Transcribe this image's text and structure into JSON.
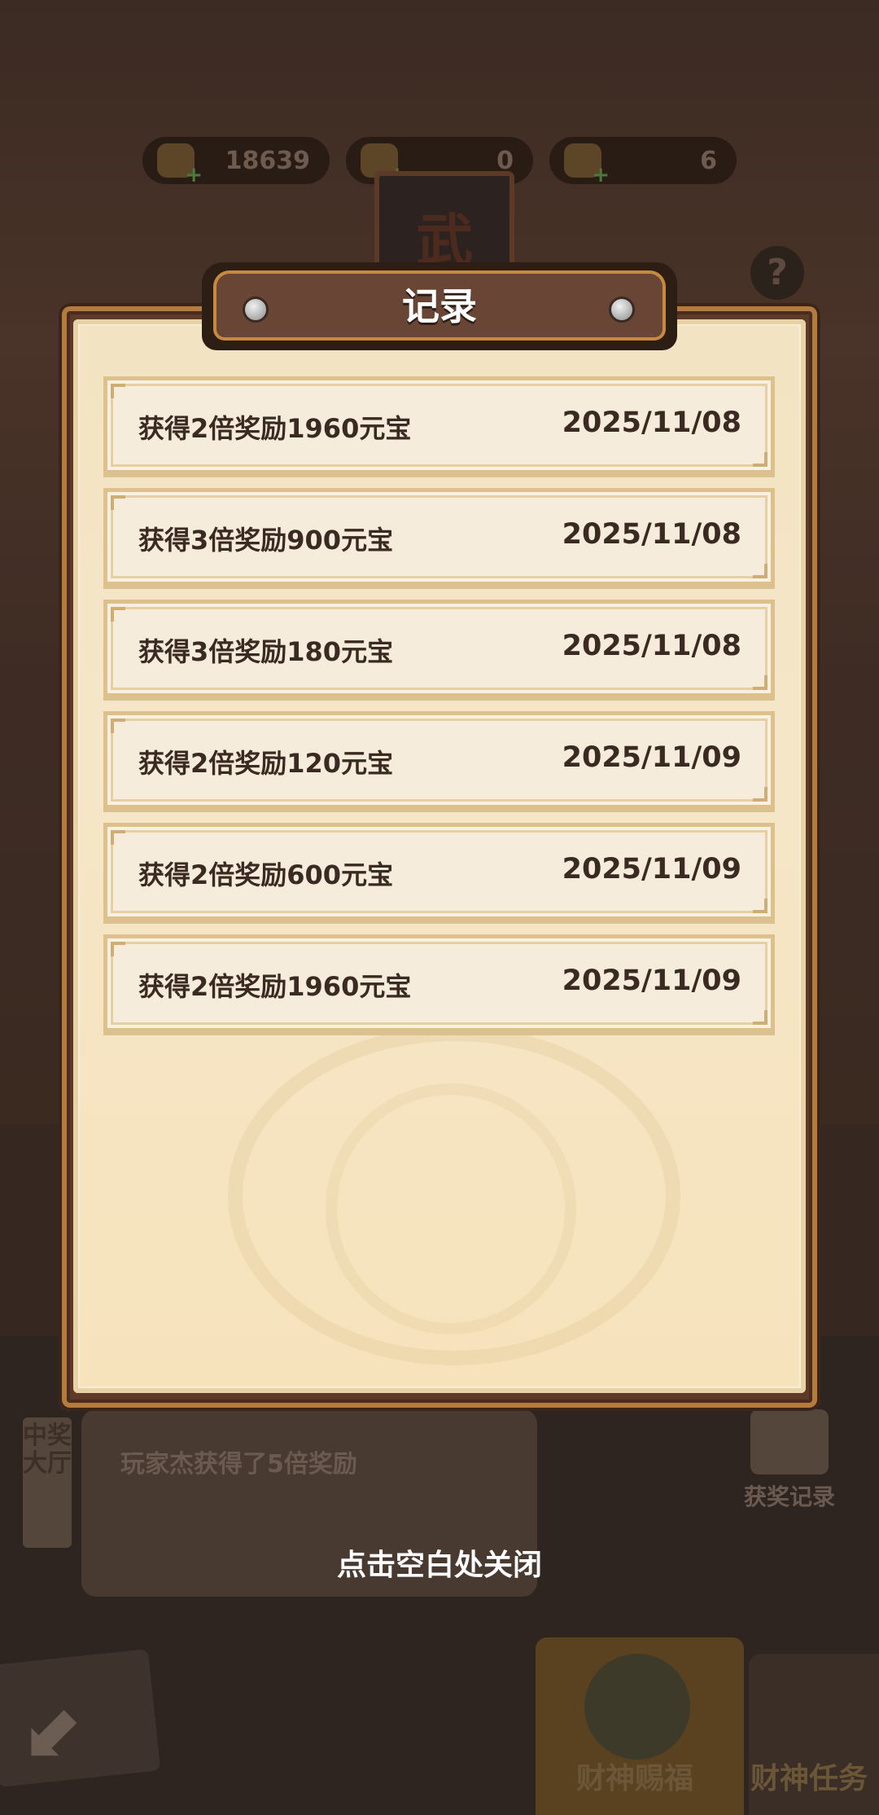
{
  "currencies": [
    {
      "icon": "gold-ingot-icon",
      "value": "18639"
    },
    {
      "icon": "leaf-token-icon",
      "value": "0"
    },
    {
      "icon": "treasure-icon",
      "value": "6"
    }
  ],
  "shrine": {
    "character": "武"
  },
  "help": {
    "label": "?"
  },
  "modal": {
    "title": "记录",
    "records": [
      {
        "desc": "获得2倍奖励1960元宝",
        "date": "2025/11/08"
      },
      {
        "desc": "获得3倍奖励900元宝",
        "date": "2025/11/08"
      },
      {
        "desc": "获得3倍奖励180元宝",
        "date": "2025/11/08"
      },
      {
        "desc": "获得2倍奖励120元宝",
        "date": "2025/11/09"
      },
      {
        "desc": "获得2倍奖励600元宝",
        "date": "2025/11/09"
      },
      {
        "desc": "获得2倍奖励1960元宝",
        "date": "2025/11/09"
      }
    ]
  },
  "ticker": {
    "side_label": "中奖大厅",
    "text": "玩家杰获得了5倍奖励"
  },
  "win_record": {
    "label": "获奖记录"
  },
  "close_hint": "点击空白处关闭",
  "bottom_tabs": [
    {
      "label": "财神赐福",
      "active": true
    },
    {
      "label": "财神任务",
      "active": false
    }
  ],
  "colors": {
    "paper": "#f5e6c8",
    "frame": "#5e3b27",
    "accent_gold": "#c8893e",
    "text_dark": "#3b2a22"
  }
}
